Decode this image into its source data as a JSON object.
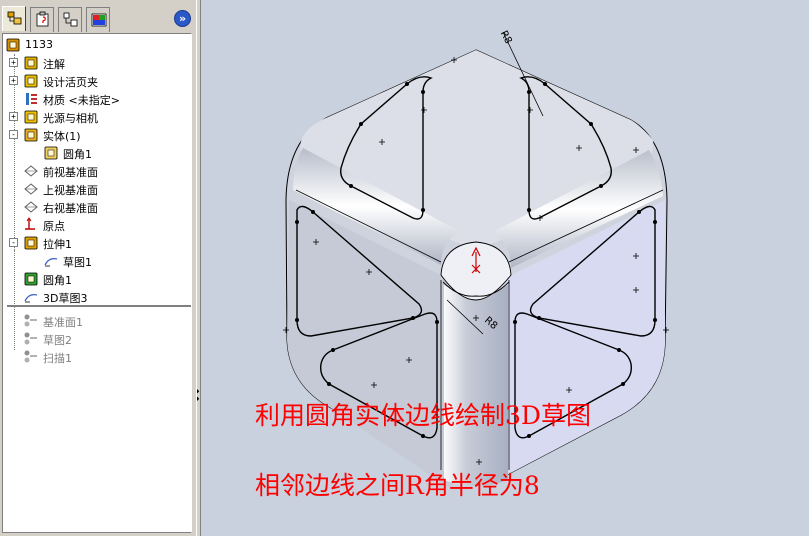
{
  "panel": {
    "tabs": [
      "feature-manager",
      "property-manager",
      "configuration-manager",
      "display-manager"
    ],
    "collapse_glyph": "»",
    "tree": [
      {
        "label": "1133",
        "icon": "part-icon",
        "expander": ""
      },
      {
        "label": "注解",
        "icon": "annotation-icon",
        "expander": "+"
      },
      {
        "label": "设计活页夹",
        "icon": "design-binder-icon",
        "expander": "+"
      },
      {
        "label": "材质 <未指定>",
        "icon": "material-icon",
        "expander": ""
      },
      {
        "label": "光源与相机",
        "icon": "lights-camera-icon",
        "expander": "+"
      },
      {
        "label": "实体(1)",
        "icon": "solid-bodies-icon",
        "expander": "-"
      },
      {
        "label": "圆角1",
        "icon": "body-icon",
        "expander": ""
      },
      {
        "label": "前视基准面",
        "icon": "plane-icon",
        "expander": ""
      },
      {
        "label": "上视基准面",
        "icon": "plane-icon",
        "expander": ""
      },
      {
        "label": "右视基准面",
        "icon": "plane-icon",
        "expander": ""
      },
      {
        "label": "原点",
        "icon": "origin-icon",
        "expander": ""
      },
      {
        "label": "拉伸1",
        "icon": "extrude-icon",
        "expander": "-"
      },
      {
        "label": "草图1",
        "icon": "sketch-icon",
        "expander": ""
      },
      {
        "label": "圆角1",
        "icon": "fillet-icon",
        "expander": ""
      },
      {
        "label": "3D草图3",
        "icon": "3d-sketch-icon",
        "expander": ""
      },
      {
        "label": "基准面1",
        "icon": "suppressed-feature-icon",
        "expander": "",
        "suppressed": true
      },
      {
        "label": "草图2",
        "icon": "suppressed-feature-icon",
        "expander": "",
        "suppressed": true
      },
      {
        "label": "扫描1",
        "icon": "suppressed-feature-icon",
        "expander": "",
        "suppressed": true
      }
    ]
  },
  "viewport": {
    "dimension_labels": [
      "R8",
      "R8"
    ],
    "caption_line1": "利用圆角实体边线绘制3D草图",
    "caption_line2": "相邻边线之间R角半径为8"
  },
  "colors": {
    "background": "#c8d1dd",
    "caption": "#ff0000",
    "sketch_line": "#000000",
    "selected_face": "#d8daf2"
  }
}
